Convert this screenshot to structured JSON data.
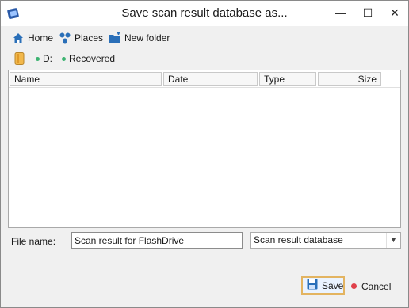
{
  "window": {
    "title": "Save scan result database as..."
  },
  "toolbar": {
    "home_label": "Home",
    "places_label": "Places",
    "new_folder_label": "New folder"
  },
  "breadcrumb": {
    "items": [
      "D:",
      "Recovered"
    ]
  },
  "file_list": {
    "columns": [
      "Name",
      "Date",
      "Type",
      "Size"
    ],
    "rows": []
  },
  "filename": {
    "label": "File name:",
    "value": "Scan result for FlashDrive"
  },
  "filetype": {
    "selected": "Scan result database"
  },
  "buttons": {
    "save_label": "Save",
    "cancel_label": "Cancel"
  },
  "colors": {
    "accent": "#2a6fb8",
    "save_border": "#e3b461",
    "status_dot": "#3cb371",
    "cancel_dot": "#e0404a"
  },
  "icons": {
    "app": "app-icon",
    "home": "home-icon",
    "places": "places-icon",
    "new_folder": "new-folder-icon",
    "drive": "drive-icon",
    "save": "floppy-icon"
  }
}
